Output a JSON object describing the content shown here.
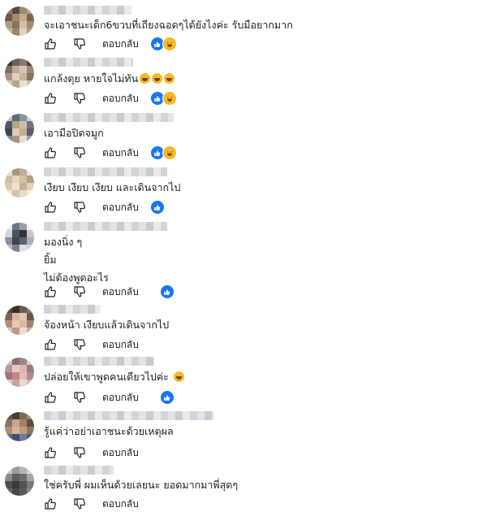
{
  "actions": {
    "reply_label": "ตอบกลับ",
    "like_icon": "thumbs-up-icon",
    "dislike_icon": "thumbs-down-icon"
  },
  "reaction_colors": {
    "like": "#1877f2",
    "haha": "#f7b928"
  },
  "comments": [
    {
      "lines": [
        "จะเอาชนะเด็ก6ขวบที่เถียงฉอดๆได้ยังไงค่ะ รับมือยากมาก"
      ],
      "reactions": [
        "like",
        "haha"
      ]
    },
    {
      "lines": [
        "แกล้งตุย หายใจไม่ทัน"
      ],
      "inline_emoji_count": 3,
      "reactions": [
        "like",
        "haha"
      ]
    },
    {
      "lines": [
        "เอามือปิดจมูก"
      ],
      "reactions": [
        "like",
        "haha"
      ]
    },
    {
      "lines": [
        "เงียบ เงียบ เงียบ และเดินจากไป"
      ],
      "reactions": [
        "like"
      ]
    },
    {
      "lines": [
        "มองนิ่ง ๆ",
        "ยิ้ม",
        "ไม่ต้องพูดอะไร"
      ],
      "reactions": [
        "like"
      ]
    },
    {
      "lines": [
        "จ้องหน้า เงียบแล้วเดินจากไป"
      ],
      "reactions": []
    },
    {
      "lines": [
        "ปล่อยให้เขาพูดคนเดียวไปค่ะ"
      ],
      "inline_emoji_count": 1,
      "reactions": [
        "like"
      ]
    },
    {
      "lines": [
        "รู้แค่ว่าอย่าเอาชนะด้วยเหตุผล"
      ],
      "reactions": []
    },
    {
      "lines": [
        "ใช่ครับพี่ ผมเห็นด้วยเลยนะ ยอดมากมาพี่สุดๆ"
      ],
      "reactions": []
    }
  ]
}
